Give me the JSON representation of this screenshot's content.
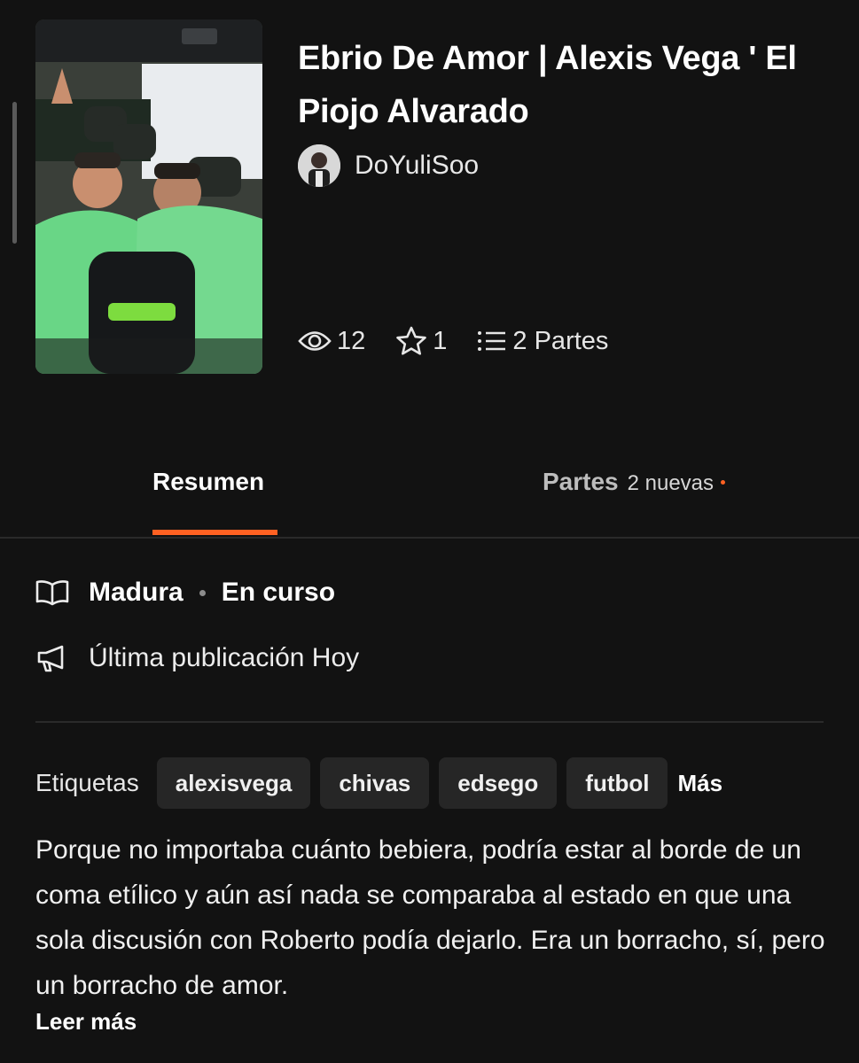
{
  "story": {
    "title": "Ebrio De Amor | Alexis Vega ' El Piojo Alvarado",
    "author": "DoYuliSoo"
  },
  "stats": {
    "reads": "12",
    "votes": "1",
    "parts": "2 Partes"
  },
  "tabs": {
    "summary": "Resumen",
    "parts": "Partes",
    "parts_new": "2 nuevas"
  },
  "details": {
    "rating": "Madura",
    "status": "En curso",
    "last_published": "Última publicación Hoy"
  },
  "tags": {
    "label": "Etiquetas",
    "items": [
      "alexisvega",
      "chivas",
      "edsego",
      "futbol"
    ],
    "more": "Más"
  },
  "description": "Porque no importaba cuánto bebiera, podría estar al borde de un coma etílico y aún así nada se comparaba al estado en que una sola discusión con Roberto podía dejarlo. Era un borracho, sí, pero un borracho de amor.",
  "read_more": "Leer más",
  "icons": {
    "reads": "eye-icon",
    "votes": "star-icon",
    "parts": "list-icon",
    "rating": "open-book-icon",
    "publication": "megaphone-icon"
  },
  "colors": {
    "background": "#121212",
    "accent": "#ff6122",
    "tag_background": "#262626"
  }
}
